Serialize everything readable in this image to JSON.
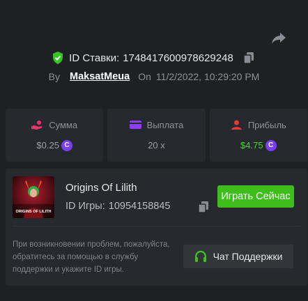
{
  "header": {
    "bet_id_label": "ID Ставки:",
    "bet_id_value": "1748417600978629248",
    "by_label": "By",
    "username": "MaksatMeua",
    "on_label": "On",
    "date": "11/2/2022, 10:29:20 PM"
  },
  "stats": {
    "amount": {
      "label": "Сумма",
      "value": "$0.25"
    },
    "payout": {
      "label": "Выплата",
      "value": "20 x"
    },
    "profit": {
      "label": "Прибыль",
      "value": "$4.75"
    }
  },
  "game": {
    "title": "Origins Of Lilith",
    "id_label": "ID Игры:",
    "id_value": "10954158845",
    "thumb_text": "ORIGINS OF LILITH",
    "play_label": "Играть Сейчас"
  },
  "support": {
    "help_text": "При возникновении проблем, пожалуйста, обратитесь за помощью в службу поддержки и укажите ID игры.",
    "button_label": "Чат Поддержки"
  },
  "colors": {
    "background": "#1e2124",
    "panel": "#26292d",
    "accent_green": "#3fbd1c",
    "coin_purple": "#7b3ff0",
    "profit_green": "#49d23a",
    "amount_icon_pink": "#e8336b",
    "payout_icon_purple": "#8b3ff0",
    "profit_icon_red": "#e83a3a"
  },
  "icons": {
    "share": "share-icon",
    "shield": "shield-check-icon",
    "copy": "copy-icon",
    "amount": "hand-coins-icon",
    "payout": "wallet-icon",
    "profit": "user-profit-icon",
    "coin": "coin-icon",
    "support": "headphones-icon"
  }
}
